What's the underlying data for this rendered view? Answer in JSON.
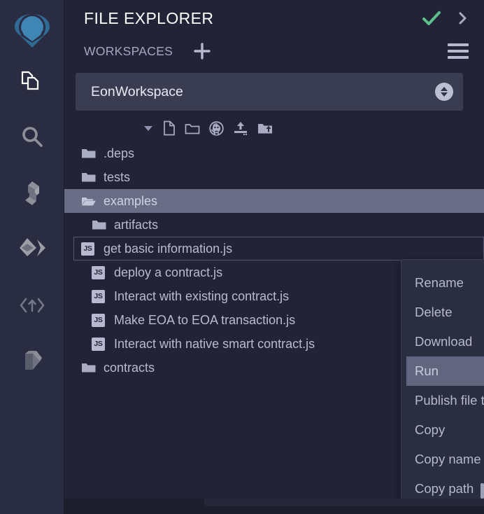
{
  "colors": {
    "rail_bg": "#2a2c41",
    "panel_bg": "#222336",
    "accent_logo": "#3f7fad",
    "check_green": "#5cc08c",
    "text_primary": "#ffffff",
    "text_muted": "#b8bbd1",
    "selection": "#6a6d86",
    "menu_bg": "#2b2d40",
    "menu_active": "#62657e",
    "select_bg": "#3a3c51"
  },
  "rail": {
    "logo_name": "remix-logo",
    "items": [
      {
        "name": "sidebar-item-file-explorer",
        "icon": "files-icon",
        "active": true
      },
      {
        "name": "sidebar-item-search",
        "icon": "search-icon",
        "active": false
      },
      {
        "name": "sidebar-item-solidity-compiler",
        "icon": "solidity-icon",
        "active": false
      },
      {
        "name": "sidebar-item-deploy-run",
        "icon": "ethereum-deploy-icon",
        "active": false
      },
      {
        "name": "sidebar-item-debugger",
        "icon": "code-arrow-icon",
        "active": false
      },
      {
        "name": "sidebar-item-plugin-manager",
        "icon": "plugin-play-icon",
        "active": false
      }
    ]
  },
  "header": {
    "title": "FILE EXPLORER",
    "check_icon": "check-icon",
    "chevron_icon": "chevron-right-icon"
  },
  "workspaces": {
    "label": "WORKSPACES",
    "plus_icon": "plus-icon",
    "burger_icon": "hamburger-menu-icon",
    "selected": "EonWorkspace",
    "select_arrows_icon": "sort-up-down-icon"
  },
  "tree_toolbar": {
    "items": [
      {
        "name": "collapse-all-caret-icon",
        "icon": "caret-down-icon"
      },
      {
        "name": "new-file-icon",
        "icon": "file-icon"
      },
      {
        "name": "new-folder-icon",
        "icon": "folder-icon"
      },
      {
        "name": "github-clone-icon",
        "icon": "github-icon"
      },
      {
        "name": "upload-file-icon",
        "icon": "upload-icon"
      },
      {
        "name": "upload-folder-icon",
        "icon": "folder-upload-icon"
      }
    ]
  },
  "tree": {
    "rows": [
      {
        "label": ".deps",
        "icon": "folder-closed-icon",
        "indent": 1,
        "state": "normal"
      },
      {
        "label": "tests",
        "icon": "folder-closed-icon",
        "indent": 1,
        "state": "normal"
      },
      {
        "label": "examples",
        "icon": "folder-open-icon",
        "indent": 1,
        "state": "selected"
      },
      {
        "label": "artifacts",
        "icon": "folder-closed-icon",
        "indent": 2,
        "state": "normal"
      },
      {
        "label": "get basic information.js",
        "icon": "js-file-icon",
        "indent": 2,
        "state": "focused"
      },
      {
        "label": "deploy a contract.js",
        "icon": "js-file-icon",
        "indent": 2,
        "state": "normal"
      },
      {
        "label": "Interact with existing contract.js",
        "icon": "js-file-icon",
        "indent": 2,
        "state": "normal"
      },
      {
        "label": "Make EOA to EOA transaction.js",
        "icon": "js-file-icon",
        "indent": 2,
        "state": "normal"
      },
      {
        "label": "Interact with native smart contract.js",
        "icon": "js-file-icon",
        "indent": 2,
        "state": "normal"
      },
      {
        "label": "contracts",
        "icon": "folder-closed-icon",
        "indent": 1,
        "state": "normal"
      }
    ],
    "js_badge_text": "JS"
  },
  "context_menu": {
    "items": [
      {
        "label": "Rename",
        "active": false
      },
      {
        "label": "Delete",
        "active": false
      },
      {
        "label": "Download",
        "active": false
      },
      {
        "label": "Run",
        "active": true
      },
      {
        "label": "Publish file to gist",
        "active": false
      },
      {
        "label": "Copy",
        "active": false
      },
      {
        "label": "Copy name",
        "active": false
      },
      {
        "label": "Copy path",
        "active": false
      }
    ]
  }
}
